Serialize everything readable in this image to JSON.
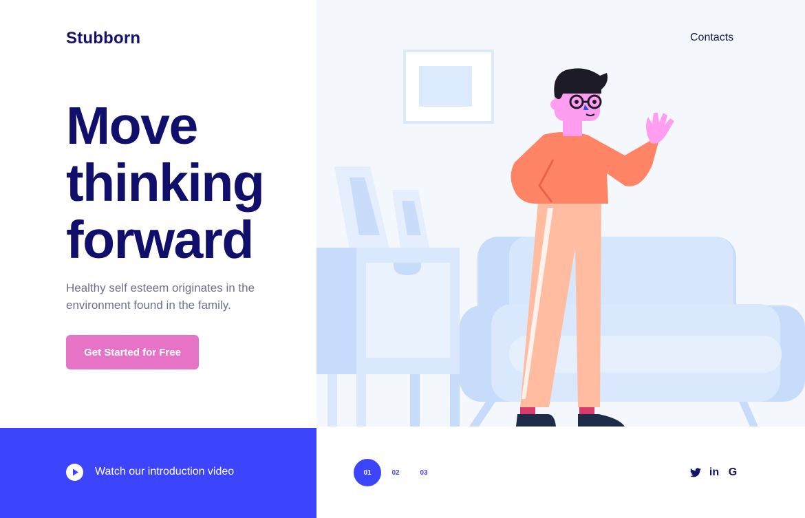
{
  "brand": {
    "logo": "Stubborn"
  },
  "nav": {
    "contacts_label": "Contacts"
  },
  "hero": {
    "headline_lines": [
      "Move",
      "thinking",
      "forward"
    ],
    "subtitle": "Healthy self esteem originates in the environment found in the family.",
    "cta_label": "Get Started for Free"
  },
  "video": {
    "label": "Watch our introduction video"
  },
  "pager": {
    "pages": [
      "01",
      "02",
      "03"
    ],
    "active_index": 0
  },
  "social": {
    "items": [
      {
        "name": "twitter-icon",
        "glyph": ""
      },
      {
        "name": "linkedin-icon",
        "glyph": "in"
      },
      {
        "name": "google-icon",
        "glyph": "G"
      }
    ]
  },
  "colors": {
    "brand_navy": "#13116b",
    "accent_blue": "#3c45fb",
    "cta_pink": "#e773c6",
    "subtitle_gray": "#6c6f93",
    "illustration_bg": "#f4f8fd"
  }
}
